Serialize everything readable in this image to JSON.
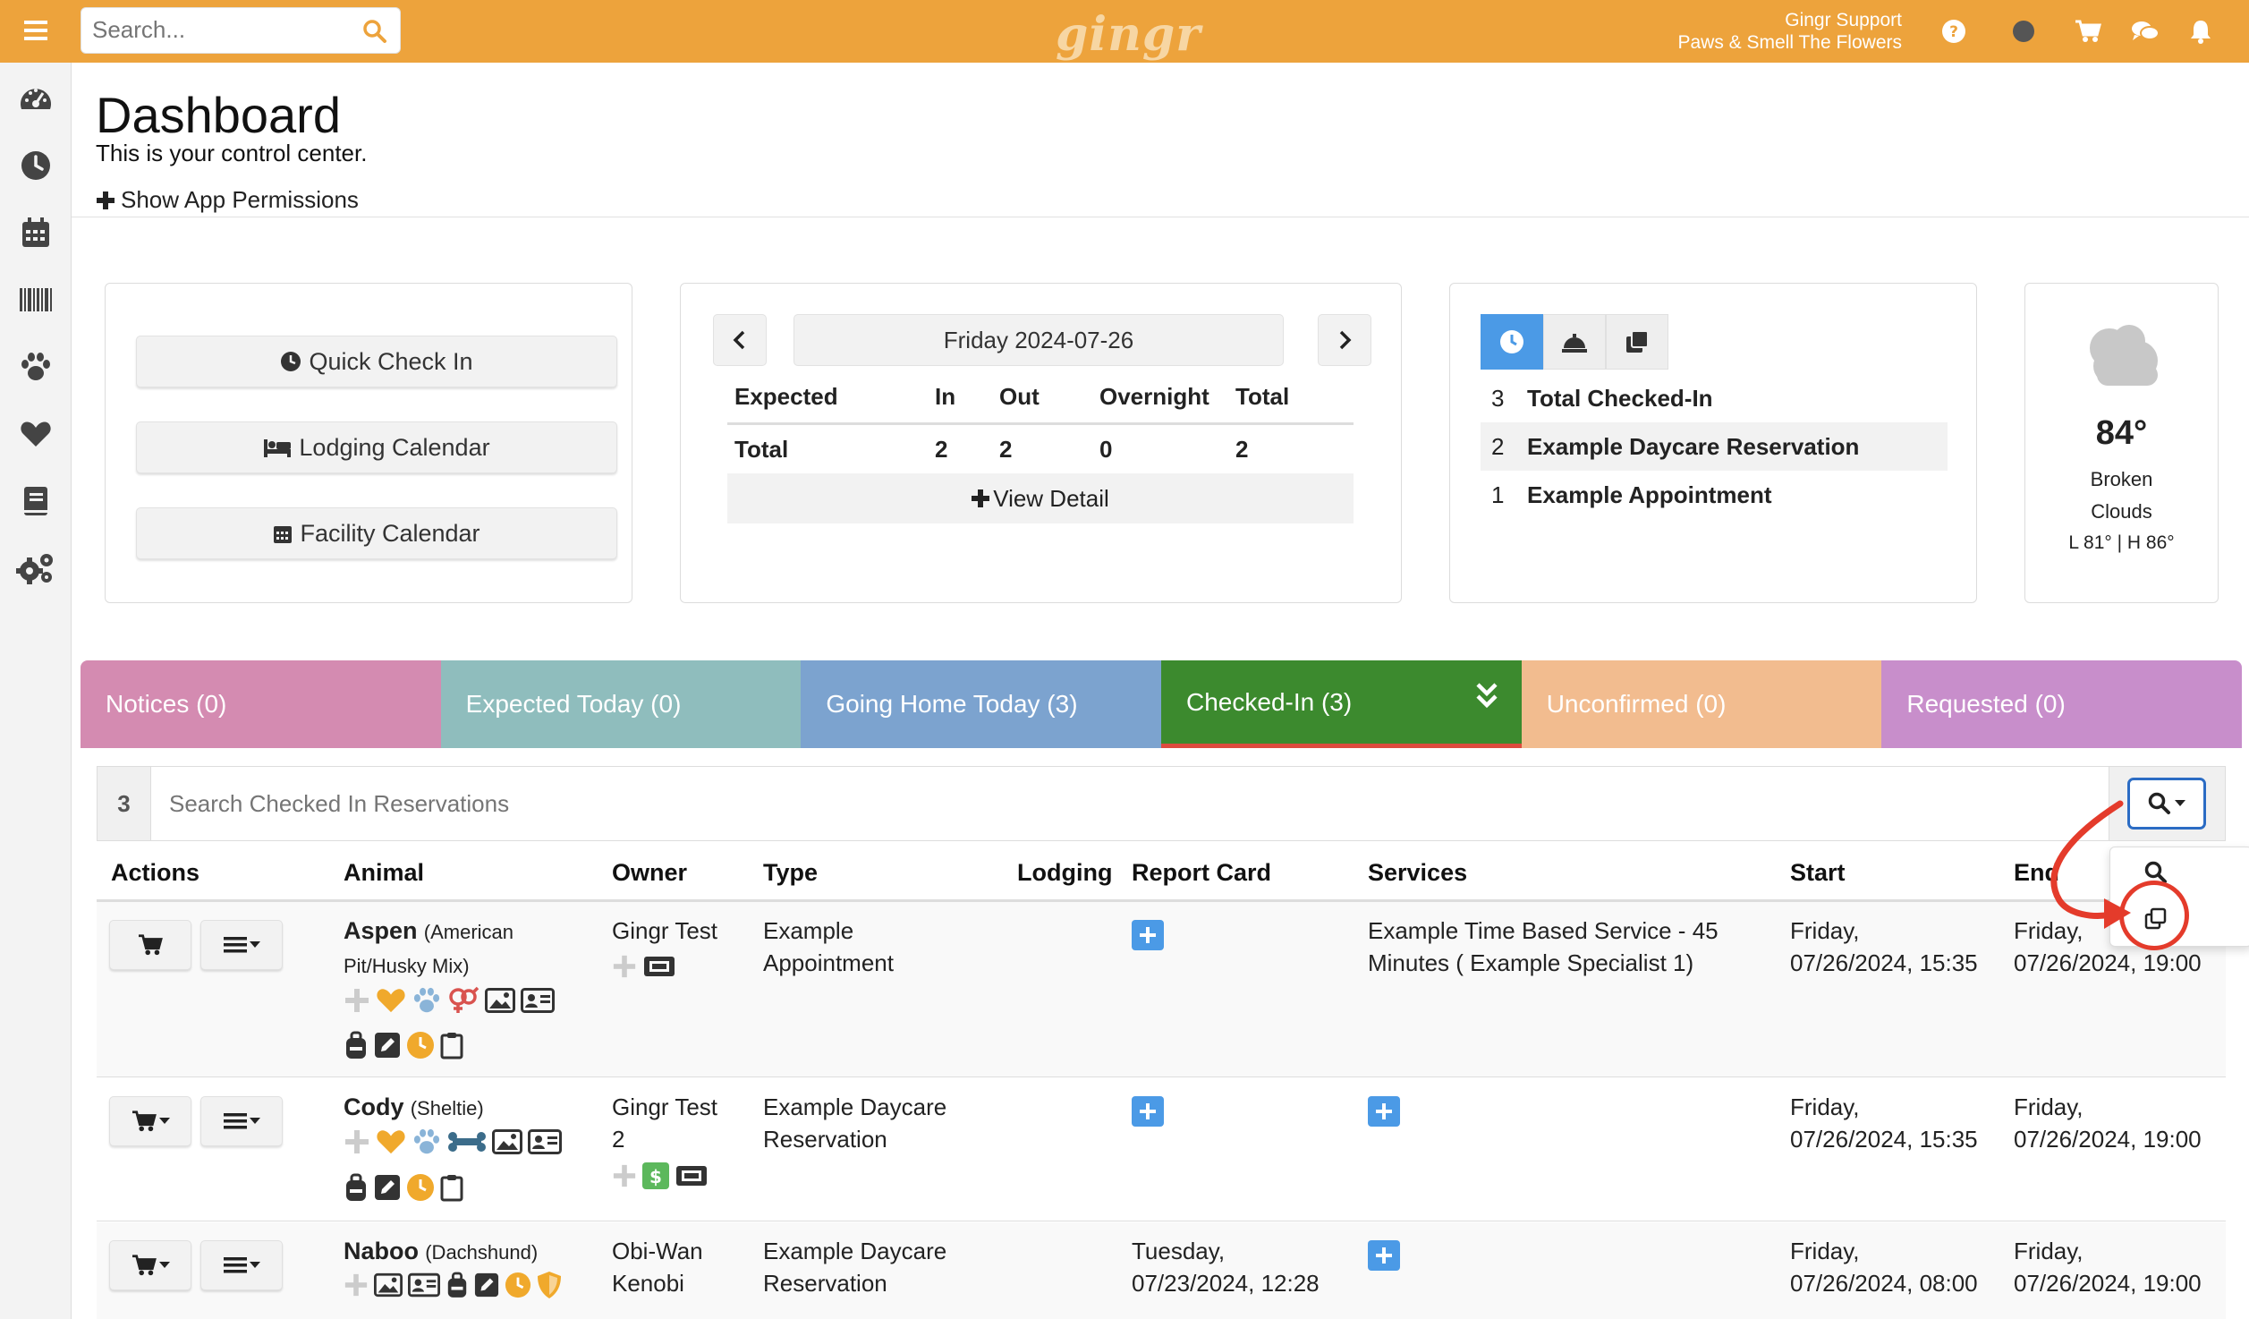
{
  "app": {
    "search_placeholder": "Search...",
    "logo": "gingr",
    "user_name": "Gingr Support",
    "business_name": "Paws & Smell The Flowers",
    "accent_color": "#eda33c"
  },
  "header": {
    "title": "Dashboard",
    "subtitle": "This is your control center.",
    "permissions_link": "Show App Permissions"
  },
  "quick_actions": {
    "quick_check_in": "Quick Check In",
    "lodging_calendar": "Lodging Calendar",
    "facility_calendar": "Facility Calendar"
  },
  "summary": {
    "date": "Friday 2024-07-26",
    "columns": [
      "Expected",
      "In",
      "Out",
      "Overnight",
      "Total"
    ],
    "row": [
      "Total",
      "2",
      "2",
      "0",
      "2"
    ],
    "view_detail": "View Detail"
  },
  "checked_in_summary": {
    "rows": [
      {
        "count": "3",
        "label": "Total Checked-In"
      },
      {
        "count": "2",
        "label": "Example Daycare Reservation"
      },
      {
        "count": "1",
        "label": "Example Appointment"
      }
    ]
  },
  "weather": {
    "temp": "84°",
    "condition_line1": "Broken",
    "condition_line2": "Clouds",
    "range": "L 81° | H 86°"
  },
  "tabs": [
    {
      "label": "Notices (0)",
      "color": "#d48bb1"
    },
    {
      "label": "Expected Today (0)",
      "color": "#8fbdbd"
    },
    {
      "label": "Going Home Today (3)",
      "color": "#7ca3cf"
    },
    {
      "label": "Checked-In (3)",
      "color": "#3c8a2e"
    },
    {
      "label": "Unconfirmed (0)",
      "color": "#f2bc8f"
    },
    {
      "label": "Requested (0)",
      "color": "#c88ecb"
    }
  ],
  "checked_in_search": {
    "count": "3",
    "placeholder": "Search Checked In Reservations"
  },
  "table": {
    "headers": [
      "Actions",
      "Animal",
      "Owner",
      "Type",
      "Lodging",
      "Report Card",
      "Services",
      "Start",
      "End"
    ],
    "rows": [
      {
        "animal": "Aspen",
        "breed_line1": "(American",
        "breed_line2": "Pit/Husky Mix)",
        "owner_line1": "Gingr Test",
        "owner_line2": "",
        "type_line1": "Example",
        "type_line2": "Appointment",
        "report_card_line1": "",
        "report_card_line2": "",
        "services_line1": "Example Time Based Service - 45",
        "services_line2": "Minutes ( Example Specialist 1)",
        "start_line1": "Friday,",
        "start_line2": "07/26/2024, 15:35",
        "end_line1": "Friday,",
        "end_line2": "07/26/2024, 19:00"
      },
      {
        "animal": "Cody",
        "breed_line1": "(Sheltie)",
        "breed_line2": "",
        "owner_line1": "Gingr Test",
        "owner_line2": "2",
        "type_line1": "Example Daycare",
        "type_line2": "Reservation",
        "report_card_line1": "",
        "report_card_line2": "",
        "services_line1": "",
        "services_line2": "",
        "start_line1": "Friday,",
        "start_line2": "07/26/2024, 15:35",
        "end_line1": "Friday,",
        "end_line2": "07/26/2024, 19:00"
      },
      {
        "animal": "Naboo",
        "breed_line1": "(Dachshund)",
        "breed_line2": "",
        "owner_line1": "Obi-Wan",
        "owner_line2": "Kenobi",
        "type_line1": "Example Daycare",
        "type_line2": "Reservation",
        "report_card_line1": "Tuesday,",
        "report_card_line2": "07/23/2024, 12:28",
        "services_line1": "",
        "services_line2": "",
        "start_line1": "Friday,",
        "start_line2": "07/26/2024, 08:00",
        "end_line1": "Friday,",
        "end_line2": "07/26/2024, 19:00"
      }
    ]
  }
}
